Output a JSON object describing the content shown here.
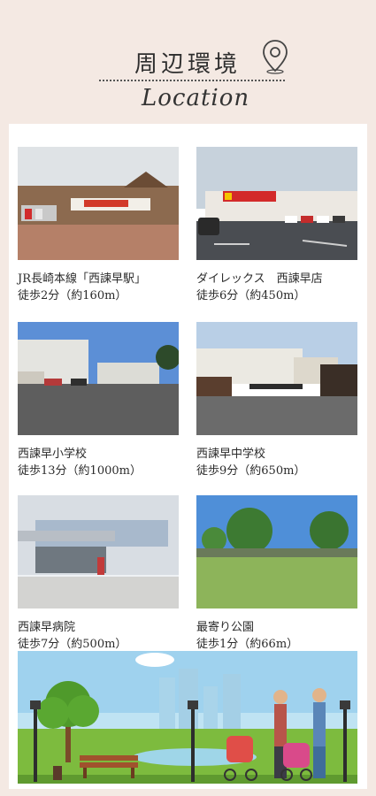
{
  "header": {
    "title": "周辺環境",
    "subtitle": "Location",
    "pin_icon": "location-pin-icon"
  },
  "items": [
    {
      "line1": "JR長崎本線「西諫早駅」",
      "line2": "徒歩2分（約160m）"
    },
    {
      "line1": "ダイレックス　西諫早店",
      "line2": "徒歩6分（約450m）"
    },
    {
      "line1": "西諫早小学校",
      "line2": "徒歩13分（約1000m）"
    },
    {
      "line1": "西諫早中学校",
      "line2": "徒歩9分（約650m）"
    },
    {
      "line1": "西諫早病院",
      "line2": "徒歩7分（約500m）"
    },
    {
      "line1": "最寄り公園",
      "line2": "徒歩1分（約66m）"
    }
  ],
  "colors": {
    "background": "#f4e9e3",
    "card": "#ffffff",
    "text": "#2b2b2b"
  }
}
